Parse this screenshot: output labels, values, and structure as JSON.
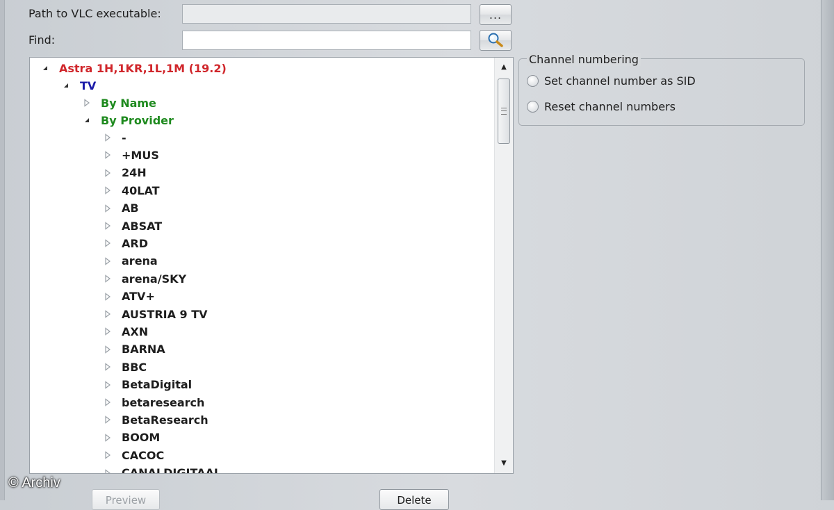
{
  "form": {
    "vlc_path_label": "Path to VLC executable:",
    "vlc_path_value": "",
    "browse_label": "...",
    "find_label": "Find:",
    "find_value": "",
    "search_icon": "magnifier-icon"
  },
  "tree": {
    "root": {
      "label": "Astra 1H,1KR,1L,1M (19.2)",
      "color": "#d0262b",
      "expanded": true
    },
    "tv": {
      "label": "TV",
      "color": "#1a1aa8",
      "expanded": true
    },
    "groups": [
      {
        "label": "By Name",
        "color": "#1e8a1e",
        "expanded": false
      },
      {
        "label": "By Provider",
        "color": "#1e8a1e",
        "expanded": true
      }
    ],
    "providers": [
      "-",
      "+MUS",
      "24H",
      "40LAT",
      "AB",
      "ABSAT",
      "ARD",
      "arena",
      "arena/SKY",
      "ATV+",
      "AUSTRIA 9 TV",
      "AXN",
      "BARNA",
      "BBC",
      "BetaDigital",
      "betaresearch",
      "BetaResearch",
      "BOOM",
      "CACOC",
      "CANALDIGITAAL"
    ]
  },
  "channel_numbering": {
    "title": "Channel numbering",
    "options": [
      {
        "label": "Set channel number as SID",
        "selected": false
      },
      {
        "label": "Reset channel numbers",
        "selected": false
      }
    ]
  },
  "buttons": {
    "preview": "Preview",
    "delete": "Delete"
  },
  "watermark": "© Archiv"
}
